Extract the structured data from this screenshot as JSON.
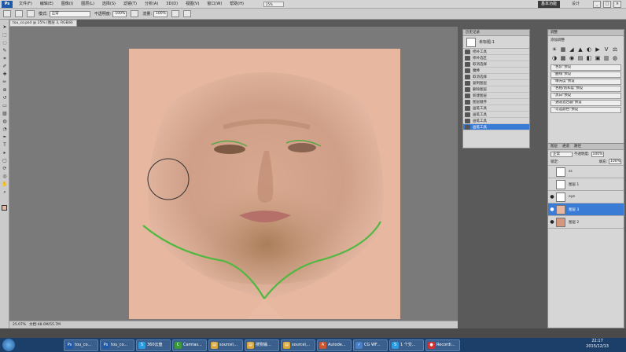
{
  "menu": {
    "logo": "Ps",
    "items": [
      "文件(F)",
      "编辑(E)",
      "图像(I)",
      "图层(L)",
      "选择(S)",
      "滤镜(T)",
      "分析(A)",
      "3D(D)",
      "视图(V)",
      "窗口(W)",
      "帮助(H)"
    ],
    "zoom": "25%",
    "workspace": "基本功能",
    "workspace2": "设计",
    "window_buttons": [
      "_",
      "□",
      "×"
    ]
  },
  "options": {
    "mode_label": "模式:",
    "mode_value": "正常",
    "opacity_label": "不透明度:",
    "opacity_value": "100%",
    "flow_label": "流量:",
    "flow_value": "100%"
  },
  "document_tab": "tou_co.psd @ 25% (图层 3, RGB/8)",
  "status": {
    "zoom": "25.07%",
    "doc": "文档:48.0M/55.7M"
  },
  "history_panel": {
    "title": "历史记录",
    "snapshot": "未标题-1",
    "rows": [
      {
        "label": "修补工具",
        "selected": false
      },
      {
        "label": "修补选区",
        "selected": false
      },
      {
        "label": "取消选择",
        "selected": false
      },
      {
        "label": "魔棒",
        "selected": false
      },
      {
        "label": "取消选择",
        "selected": false
      },
      {
        "label": "复制图层",
        "selected": false
      },
      {
        "label": "删除图层",
        "selected": false
      },
      {
        "label": "新建图层",
        "selected": false
      },
      {
        "label": "图层顺序",
        "selected": false
      },
      {
        "label": "画笔工具",
        "selected": false
      },
      {
        "label": "画笔工具",
        "selected": false
      },
      {
        "label": "画笔工具",
        "selected": false
      },
      {
        "label": "画笔工具",
        "selected": true
      }
    ]
  },
  "adjustments_panel": {
    "title": "调整",
    "subtitle": "添加调整",
    "icons": [
      "☀",
      "▦",
      "◢",
      "▲",
      "◐",
      "▶",
      "V",
      "⚖",
      "◑",
      "▩",
      "◉",
      "▤",
      "◧",
      "▣",
      "▥",
      "◍"
    ],
    "presets": [
      "\"色阶\"预设",
      "\"曲线\"预设",
      "\"曝光度\"预设",
      "\"色相/饱和度\"预设",
      "\"黑白\"预设",
      "\"通道混合器\"预设",
      "\"可选颜色\"预设"
    ]
  },
  "layers_panel": {
    "tabs": [
      "图层",
      "通道",
      "路径"
    ],
    "blend": "正常",
    "opacity_label": "不透明度:",
    "opacity_value": "100%",
    "fill_label": "填充:",
    "fill_value": "100%",
    "lock_label": "锁定:",
    "rows": [
      {
        "name": "ss",
        "selected": false,
        "visible": false
      },
      {
        "name": "图层 1",
        "selected": false,
        "visible": false
      },
      {
        "name": "eye",
        "selected": false,
        "visible": true
      },
      {
        "name": "图层 3",
        "selected": true,
        "visible": true
      },
      {
        "name": "图层 2",
        "selected": false,
        "visible": true
      }
    ]
  },
  "taskbar": {
    "items": [
      {
        "label": "tou_co...",
        "icon": "Ps",
        "color": "#1f5aa8"
      },
      {
        "label": "tou_co...",
        "icon": "Ps",
        "color": "#1f5aa8"
      },
      {
        "label": "360云盘",
        "icon": "S",
        "color": "#2d9be0"
      },
      {
        "label": "Camtas...",
        "icon": "C",
        "color": "#3a9a3a"
      },
      {
        "label": "source\\...",
        "icon": "▤",
        "color": "#d8a63a"
      },
      {
        "label": "搜狗输...",
        "icon": "▤",
        "color": "#d8a63a"
      },
      {
        "label": "source\\...",
        "icon": "▤",
        "color": "#d8a63a"
      },
      {
        "label": "Autode...",
        "icon": "A",
        "color": "#c9572f"
      },
      {
        "label": "CG WF...",
        "icon": "✓",
        "color": "#4a80c8"
      },
      {
        "label": "1 个交...",
        "icon": "S",
        "color": "#2d9be0"
      },
      {
        "label": "Recordi...",
        "icon": "●",
        "color": "#cc3333"
      }
    ],
    "time": "22:17",
    "date": "2015/12/13"
  }
}
